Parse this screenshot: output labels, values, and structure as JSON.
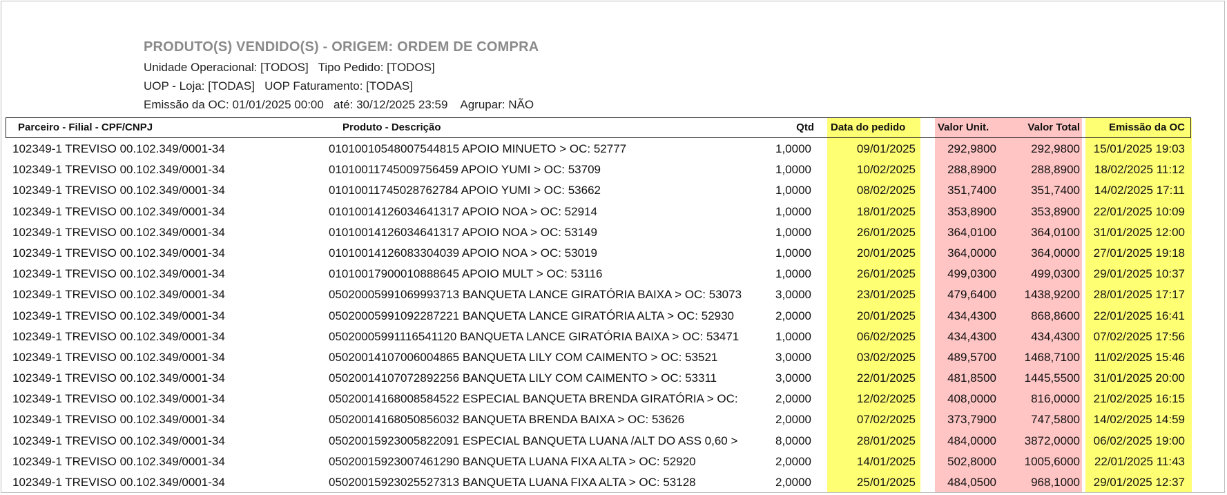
{
  "report": {
    "title": "PRODUTO(S) VENDIDO(S) - ORIGEM: ORDEM DE COMPRA",
    "line1": "Unidade Operacional: [TODOS]   Tipo Pedido: [TODOS]",
    "line2": "UOP - Loja: [TODAS]   UOP Faturamento: [TODAS]",
    "line3": "Emissão da OC: 01/01/2025 00:00   até: 30/12/2025 23:59    Agrupar: NÃO"
  },
  "colors": {
    "yellow": "#ffff74",
    "pink": "#ffc4c4"
  },
  "columns": {
    "parceiro": "Parceiro - Filial - CPF/CNPJ",
    "produto": "Produto - Descrição",
    "qtd": "Qtd",
    "data": "Data do pedido",
    "valor_unit": "Valor Unit.",
    "valor_total": "Valor Total",
    "emissao": "Emissão da OC"
  },
  "rows": [
    {
      "parceiro": "102349-1 TREVISO 00.102.349/0001-34",
      "produto": "0101001054800754481​5 APOIO MINUETO > OC: 52777",
      "qtd": "1,0000",
      "data": "09/01/2025",
      "valor_unit": "292,9800",
      "valor_total": "292,9800",
      "emissao": "15/01/2025 19:03"
    },
    {
      "parceiro": "102349-1 TREVISO 00.102.349/0001-34",
      "produto": "0101001174500975645​9 APOIO YUMI > OC: 53709",
      "qtd": "1,0000",
      "data": "10/02/2025",
      "valor_unit": "288,8900",
      "valor_total": "288,8900",
      "emissao": "18/02/2025 11:12"
    },
    {
      "parceiro": "102349-1 TREVISO 00.102.349/0001-34",
      "produto": "0101001174502876278​4 APOIO YUMI > OC: 53662",
      "qtd": "1,0000",
      "data": "08/02/2025",
      "valor_unit": "351,7400",
      "valor_total": "351,7400",
      "emissao": "14/02/2025 17:11"
    },
    {
      "parceiro": "102349-1 TREVISO 00.102.349/0001-34",
      "produto": "0101001412603464131​7 APOIO NOA > OC: 52914",
      "qtd": "1,0000",
      "data": "18/01/2025",
      "valor_unit": "353,8900",
      "valor_total": "353,8900",
      "emissao": "22/01/2025 10:09"
    },
    {
      "parceiro": "102349-1 TREVISO 00.102.349/0001-34",
      "produto": "0101001412603464131​7 APOIO NOA > OC: 53149",
      "qtd": "1,0000",
      "data": "26/01/2025",
      "valor_unit": "364,0100",
      "valor_total": "364,0100",
      "emissao": "31/01/2025 12:00"
    },
    {
      "parceiro": "102349-1 TREVISO 00.102.349/0001-34",
      "produto": "0101001412608330403​9 APOIO NOA > OC: 53019",
      "qtd": "1,0000",
      "data": "20/01/2025",
      "valor_unit": "364,0000",
      "valor_total": "364,0000",
      "emissao": "27/01/2025 19:18"
    },
    {
      "parceiro": "102349-1 TREVISO 00.102.349/0001-34",
      "produto": "0101001790001088864​5 APOIO MULT > OC: 53116",
      "qtd": "1,0000",
      "data": "26/01/2025",
      "valor_unit": "499,0300",
      "valor_total": "499,0300",
      "emissao": "29/01/2025 10:37"
    },
    {
      "parceiro": "102349-1 TREVISO 00.102.349/0001-34",
      "produto": "0502000599106999371​3 BANQUETA LANCE GIRATÓRIA BAIXA > OC: 53073",
      "qtd": "3,0000",
      "data": "23/01/2025",
      "valor_unit": "479,6400",
      "valor_total": "1438,9200",
      "emissao": "28/01/2025 17:17"
    },
    {
      "parceiro": "102349-1 TREVISO 00.102.349/0001-34",
      "produto": "0502000599109228722​1 BANQUETA LANCE GIRATÓRIA ALTA > OC: 52930",
      "qtd": "2,0000",
      "data": "20/01/2025",
      "valor_unit": "434,4300",
      "valor_total": "868,8600",
      "emissao": "22/01/2025 16:41"
    },
    {
      "parceiro": "102349-1 TREVISO 00.102.349/0001-34",
      "produto": "0502000599111654112​0 BANQUETA LANCE GIRATÓRIA BAIXA > OC: 53471",
      "qtd": "1,0000",
      "data": "06/02/2025",
      "valor_unit": "434,4300",
      "valor_total": "434,4300",
      "emissao": "07/02/2025 17:56"
    },
    {
      "parceiro": "102349-1 TREVISO 00.102.349/0001-34",
      "produto": "0502001410700600486​5 BANQUETA LILY COM CAIMENTO > OC: 53521",
      "qtd": "3,0000",
      "data": "03/02/2025",
      "valor_unit": "489,5700",
      "valor_total": "1468,7100",
      "emissao": "11/02/2025 15:46"
    },
    {
      "parceiro": "102349-1 TREVISO 00.102.349/0001-34",
      "produto": "0502001410707289225​6 BANQUETA LILY COM CAIMENTO > OC: 53311",
      "qtd": "3,0000",
      "data": "22/01/2025",
      "valor_unit": "481,8500",
      "valor_total": "1445,5500",
      "emissao": "31/01/2025 20:00"
    },
    {
      "parceiro": "102349-1 TREVISO 00.102.349/0001-34",
      "produto": "0502001416800858452​2 ESPECIAL BANQUETA BRENDA GIRATÓRIA > OC:",
      "qtd": "2,0000",
      "data": "12/02/2025",
      "valor_unit": "408,0000",
      "valor_total": "816,0000",
      "emissao": "21/02/2025 16:15"
    },
    {
      "parceiro": "102349-1 TREVISO 00.102.349/0001-34",
      "produto": "0502001416805085603​2 BANQUETA BRENDA BAIXA > OC: 53626",
      "qtd": "2,0000",
      "data": "07/02/2025",
      "valor_unit": "373,7900",
      "valor_total": "747,5800",
      "emissao": "14/02/2025 14:59"
    },
    {
      "parceiro": "102349-1 TREVISO 00.102.349/0001-34",
      "produto": "0502001592300582209​1 ESPECIAL BANQUETA LUANA /ALT DO ASS 0,60 >",
      "qtd": "8,0000",
      "data": "28/01/2025",
      "valor_unit": "484,0000",
      "valor_total": "3872,0000",
      "emissao": "06/02/2025 19:00"
    },
    {
      "parceiro": "102349-1 TREVISO 00.102.349/0001-34",
      "produto": "0502001592300746129​0 BANQUETA LUANA FIXA ALTA > OC: 52920",
      "qtd": "2,0000",
      "data": "14/01/2025",
      "valor_unit": "502,8000",
      "valor_total": "1005,6000",
      "emissao": "22/01/2025 11:43"
    },
    {
      "parceiro": "102349-1 TREVISO 00.102.349/0001-34",
      "produto": "0502001592302552731​3 BANQUETA LUANA FIXA ALTA > OC: 53128",
      "qtd": "2,0000",
      "data": "25/01/2025",
      "valor_unit": "484,0500",
      "valor_total": "968,1000",
      "emissao": "29/01/2025 12:37"
    }
  ]
}
